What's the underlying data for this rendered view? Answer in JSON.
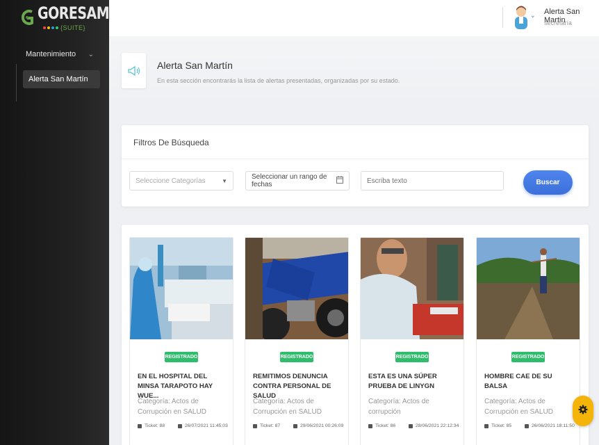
{
  "brand": {
    "name": "GORESAM",
    "suite": "{SUITE}"
  },
  "sidebar": {
    "group_label": "Mantenimiento",
    "items": [
      {
        "label": "Alerta San Martín"
      }
    ]
  },
  "topbar": {
    "user_name": "Alerta San Martin",
    "user_role": "secretaría"
  },
  "page": {
    "title": "Alerta San Martín",
    "subtitle": "En esta sección encontrarás la lista de alertas presentadas, organizadas por su estado."
  },
  "filters": {
    "title": "Filtros De Búsqueda",
    "category_placeholder": "Seleccione Categorías",
    "date_placeholder": "Seleccionar un rango de fechas",
    "text_placeholder": "Escriba texto",
    "search_button": "Buscar"
  },
  "cards": [
    {
      "status": "REGISTRADO",
      "title": "EN EL HOSPITAL DEL MINSA TARAPOTO HAY WUE...",
      "category": "Categoría: Actos de Corrupción en SALUD",
      "ticket": "Ticket: 88",
      "date": "26/07/2021 11:45:03",
      "image": "hospital-photo"
    },
    {
      "status": "REGISTRADO",
      "title": "REMITIMOS DENUNCIA CONTRA PERSONAL DE SALUD",
      "category": "Categoría: Actos de Corrupción en SALUD",
      "ticket": "Ticket: 87",
      "date": "29/06/2021 00:26:09",
      "image": "motorcycle-photo"
    },
    {
      "status": "REGISTRADO",
      "title": "ESTA ES UNA SÚPER PRUEBA DE LINYGN",
      "category": "Categoría: Actos de corrupción",
      "ticket": "Ticket: 86",
      "date": "28/06/2021 22:12:34",
      "image": "man-photo"
    },
    {
      "status": "REGISTRADO",
      "title": "HOMBRE CAE DE SU BALSA",
      "category": "Categoría: Actos de Corrupción en SALUD",
      "ticket": "Ticket: 85",
      "date": "26/06/2021 18:11:50",
      "image": "river-boat-photo"
    }
  ],
  "colors": {
    "accent": "#3c6fd9",
    "status": "#2ebd6b",
    "fab": "#f5b40a",
    "sidebar": "#1c1c1c"
  }
}
